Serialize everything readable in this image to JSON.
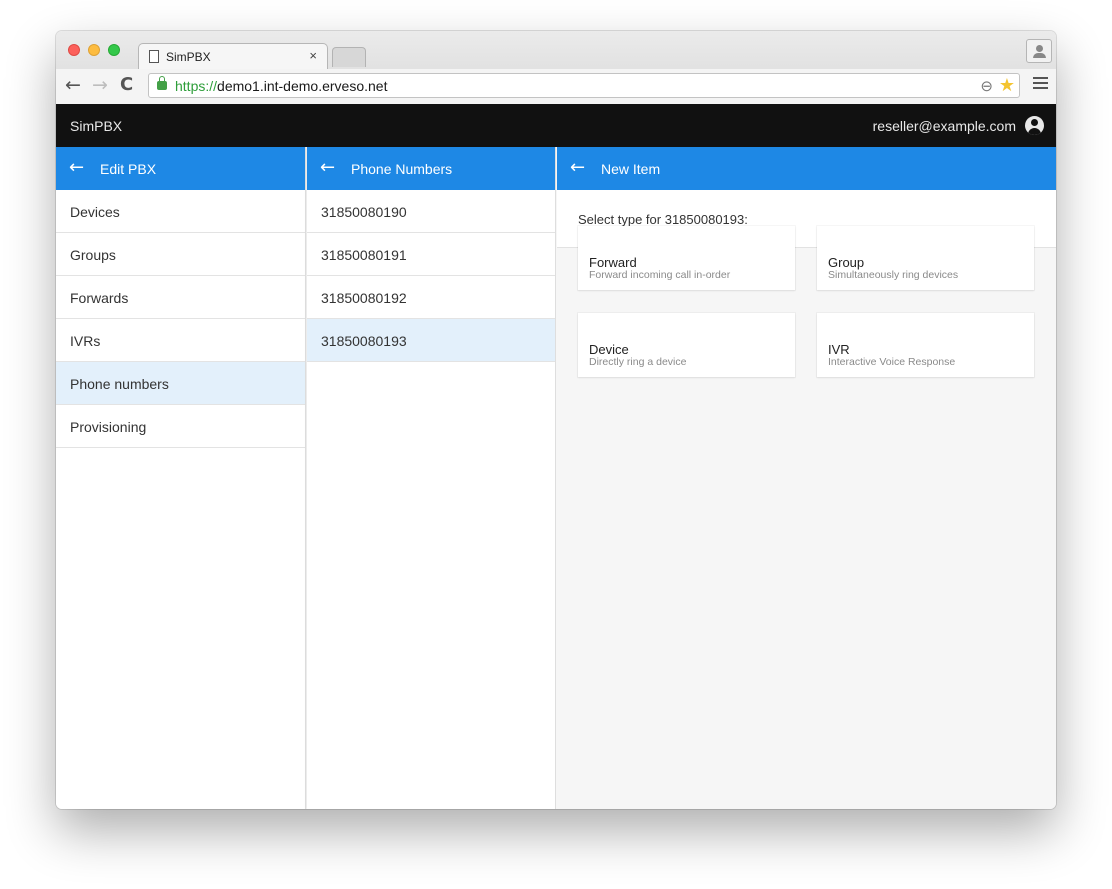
{
  "browser": {
    "tab_title": "SimPBX",
    "tab_close": "×",
    "url_scheme": "https://",
    "url_rest": "demo1.int-demo.erveso.net",
    "back_glyph": "←",
    "forward_glyph": "→",
    "reload_glyph": "C",
    "zoom_glyph": "⊖",
    "star_glyph": "★"
  },
  "app": {
    "title": "SimPBX",
    "user_email": "reseller@example.com"
  },
  "panel_pbx": {
    "title": "Edit PBX",
    "back_glyph": "←",
    "items": [
      "Devices",
      "Groups",
      "Forwards",
      "IVRs",
      "Phone numbers",
      "Provisioning"
    ],
    "selected": "Phone numbers"
  },
  "panel_numbers": {
    "title": "Phone Numbers",
    "back_glyph": "←",
    "items": [
      "31850080190",
      "31850080191",
      "31850080192",
      "31850080193"
    ],
    "selected": "31850080193"
  },
  "panel_new": {
    "title": "New Item",
    "back_glyph": "←",
    "prompt": "Select type for 31850080193:",
    "types": [
      {
        "name": "Forward",
        "description": "Forward incoming call in-order"
      },
      {
        "name": "Group",
        "description": "Simultaneously ring devices"
      },
      {
        "name": "Device",
        "description": "Directly ring a device"
      },
      {
        "name": "IVR",
        "description": "Interactive Voice Response"
      }
    ]
  },
  "colors": {
    "accent": "#1e88e5",
    "appbar": "#111111",
    "selected_row": "#e3f0fb"
  }
}
